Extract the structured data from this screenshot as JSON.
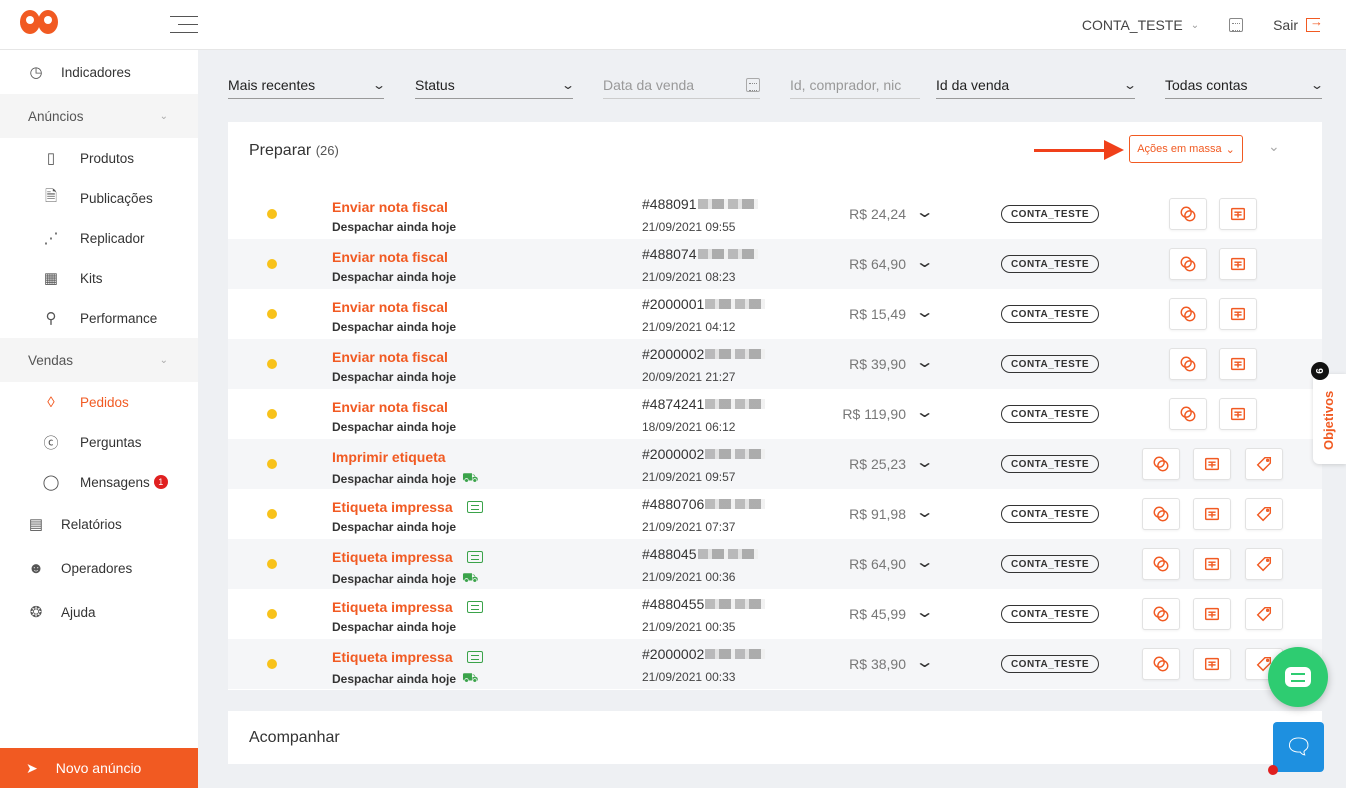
{
  "header": {
    "account": "CONTA_TESTE",
    "logout": "Sair"
  },
  "sidebar": {
    "items": [
      {
        "label": "Indicadores",
        "icon": "gauge-icon"
      },
      {
        "label": "Anúncios",
        "section": true
      },
      {
        "label": "Produtos",
        "icon": "product-icon"
      },
      {
        "label": "Publicações",
        "icon": "document-icon"
      },
      {
        "label": "Replicador",
        "icon": "share-icon"
      },
      {
        "label": "Kits",
        "icon": "kits-icon"
      },
      {
        "label": "Performance",
        "icon": "trophy-icon"
      },
      {
        "label": "Vendas",
        "section": true
      },
      {
        "label": "Pedidos",
        "icon": "tag-icon",
        "active": true
      },
      {
        "label": "Perguntas",
        "icon": "question-icon"
      },
      {
        "label": "Mensagens",
        "icon": "message-icon",
        "badge": "1"
      },
      {
        "label": "Relatórios",
        "icon": "chart-icon"
      },
      {
        "label": "Operadores",
        "icon": "operators-icon"
      },
      {
        "label": "Ajuda",
        "icon": "help-icon"
      }
    ],
    "new_listing": "Novo anúncio"
  },
  "filters": {
    "sort": "Mais recentes",
    "status": "Status",
    "date_placeholder": "Data da venda",
    "search_placeholder": "Id, comprador, nic",
    "id_type": "Id da venda",
    "accounts": "Todas contas"
  },
  "section": {
    "title": "Preparar",
    "count": "(26)",
    "bulk_actions": "Ações em massa"
  },
  "orders": [
    {
      "status": "Enviar nota fiscal",
      "sub": "Despachar ainda hoje",
      "id": "#488091",
      "date": "21/09/2021 09:55",
      "price": "R$ 24,24",
      "account": "CONTA_TESTE",
      "status_icon": false,
      "truck": false,
      "tag_action": false
    },
    {
      "status": "Enviar nota fiscal",
      "sub": "Despachar ainda hoje",
      "id": "#488074",
      "date": "21/09/2021 08:23",
      "price": "R$ 64,90",
      "account": "CONTA_TESTE",
      "status_icon": false,
      "truck": false,
      "tag_action": false
    },
    {
      "status": "Enviar nota fiscal",
      "sub": "Despachar ainda hoje",
      "id": "#2000001",
      "date": "21/09/2021 04:12",
      "price": "R$ 15,49",
      "account": "CONTA_TESTE",
      "status_icon": false,
      "truck": false,
      "tag_action": false
    },
    {
      "status": "Enviar nota fiscal",
      "sub": "Despachar ainda hoje",
      "id": "#2000002",
      "date": "20/09/2021 21:27",
      "price": "R$ 39,90",
      "account": "CONTA_TESTE",
      "status_icon": false,
      "truck": false,
      "tag_action": false
    },
    {
      "status": "Enviar nota fiscal",
      "sub": "Despachar ainda hoje",
      "id": "#4874241",
      "date": "18/09/2021 06:12",
      "price": "R$ 119,90",
      "account": "CONTA_TESTE",
      "status_icon": false,
      "truck": false,
      "tag_action": false
    },
    {
      "status": "Imprimir etiqueta",
      "sub": "Despachar ainda hoje",
      "id": "#2000002",
      "date": "21/09/2021 09:57",
      "price": "R$ 25,23",
      "account": "CONTA_TESTE",
      "status_icon": false,
      "truck": true,
      "tag_action": true
    },
    {
      "status": "Etiqueta impressa",
      "sub": "Despachar ainda hoje",
      "id": "#4880706",
      "date": "21/09/2021 07:37",
      "price": "R$ 91,98",
      "account": "CONTA_TESTE",
      "status_icon": true,
      "truck": false,
      "tag_action": true
    },
    {
      "status": "Etiqueta impressa",
      "sub": "Despachar ainda hoje",
      "id": "#488045",
      "date": "21/09/2021 00:36",
      "price": "R$ 64,90",
      "account": "CONTA_TESTE",
      "status_icon": true,
      "truck": true,
      "tag_action": true
    },
    {
      "status": "Etiqueta impressa",
      "sub": "Despachar ainda hoje",
      "id": "#4880455",
      "date": "21/09/2021 00:35",
      "price": "R$ 45,99",
      "account": "CONTA_TESTE",
      "status_icon": true,
      "truck": false,
      "tag_action": true
    },
    {
      "status": "Etiqueta impressa",
      "sub": "Despachar ainda hoje",
      "id": "#2000002",
      "date": "21/09/2021 00:33",
      "price": "R$ 38,90",
      "account": "CONTA_TESTE",
      "status_icon": true,
      "truck": true,
      "tag_action": true
    }
  ],
  "section2": {
    "title": "Acompanhar"
  },
  "objetivos": {
    "label": "Objetivos",
    "count": "6"
  },
  "colors": {
    "accent": "#f15a22",
    "pending_dot": "#f8c21b",
    "success": "#3aa34a"
  }
}
